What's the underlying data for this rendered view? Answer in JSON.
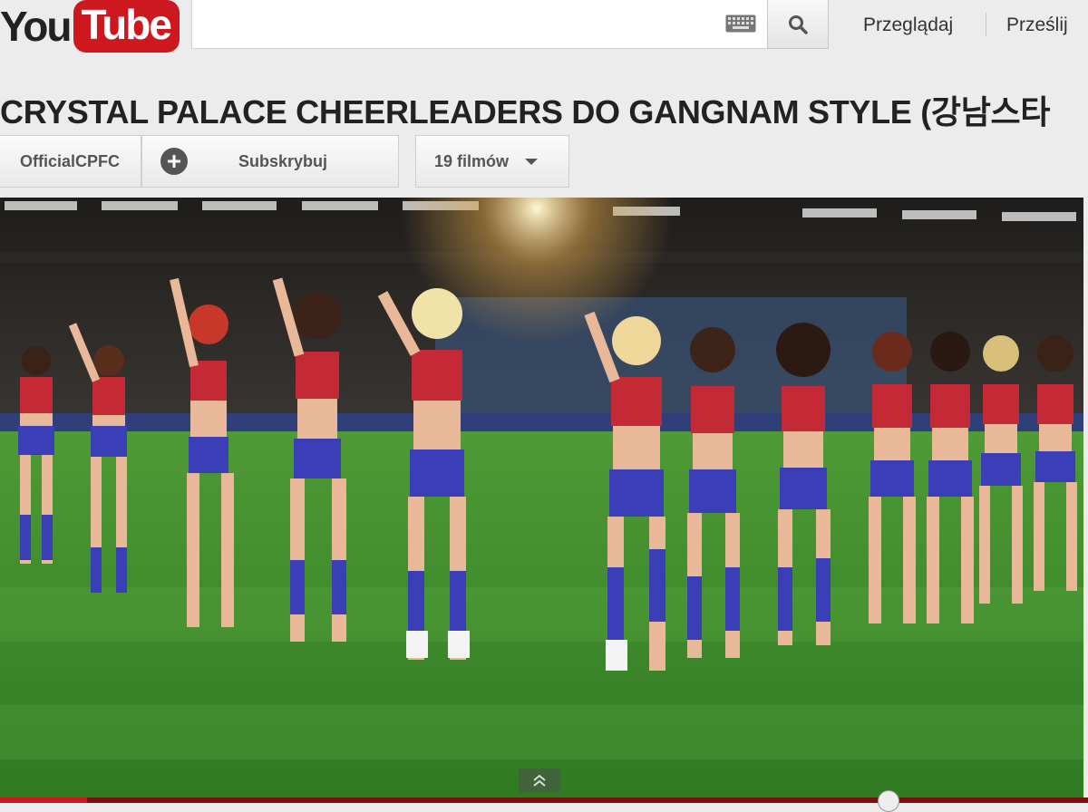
{
  "header": {
    "logo_you": "You",
    "logo_tube": "Tube",
    "search_placeholder": "",
    "keyboard_icon": "keyboard-icon",
    "search_icon": "search-icon",
    "nav_browse": "Przeglądaj",
    "nav_upload": "Prześlij"
  },
  "video": {
    "title": "CRYSTAL PALACE CHEERLEADERS DO GANGNAM STYLE (강남스타",
    "channel_name": "OfficialCPFC",
    "subscribe_label": "Subskrybuj",
    "videos_count_label": "19 filmów",
    "progress_fraction": 0.08,
    "scrub_fraction": 0.807
  },
  "colors": {
    "brand_red": "#cc181e",
    "pitch_green": "#3f8a2c",
    "kit_blue": "#3a3fb8",
    "kit_red": "#c42a35"
  }
}
